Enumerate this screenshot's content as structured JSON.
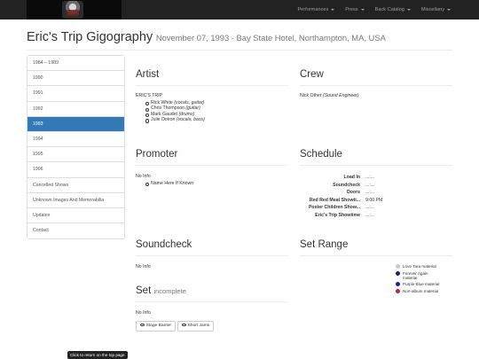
{
  "nav": {
    "items": [
      {
        "label": "Performances"
      },
      {
        "label": "Press"
      },
      {
        "label": "Back Catalog"
      },
      {
        "label": "Miscellany"
      }
    ]
  },
  "header": {
    "title": "Eric's Trip Gigography",
    "subtitle": "November 07, 1993 - Bay State Hotel, Northampton, MA, USA"
  },
  "sidebar": {
    "items": [
      {
        "label": "1984 – 1989"
      },
      {
        "label": "1990"
      },
      {
        "label": "1991"
      },
      {
        "label": "1992"
      },
      {
        "label": "1993",
        "active": true
      },
      {
        "label": "1994"
      },
      {
        "label": "1995"
      },
      {
        "label": "1996"
      },
      {
        "label": "Cancelled Shows"
      },
      {
        "label": "Unknown Images And Memorabilia"
      },
      {
        "label": "Updates"
      },
      {
        "label": "Contact"
      }
    ]
  },
  "artist": {
    "heading": "Artist",
    "name": "ERIC'S TRIP",
    "members": [
      {
        "name": "Rick White",
        "role": "(vocals, guitar)"
      },
      {
        "name": "Chris Thompson",
        "role": "(guitar)"
      },
      {
        "name": "Mark Gaudet",
        "role": "(drums)"
      },
      {
        "name": "Julie Doiron",
        "role": "(vocals, bass)"
      }
    ]
  },
  "crew": {
    "heading": "Crew",
    "name": "Nick Other",
    "role": "(Sound Engineer)"
  },
  "promoter": {
    "heading": "Promoter",
    "info": "No Info",
    "items": [
      "Name Here If Known"
    ]
  },
  "schedule": {
    "heading": "Schedule",
    "rows": [
      {
        "label": "Load In",
        "value": "...:..."
      },
      {
        "label": "Soundcheck",
        "value": "...:..."
      },
      {
        "label": "Doors",
        "value": "...:..."
      },
      {
        "label": "Red Red Meat Showti...",
        "value": "9:00 PM"
      },
      {
        "label": "Poster Children Show...",
        "value": "...:..."
      },
      {
        "label": "Eric's Trip Showtime",
        "value": "...:..."
      }
    ]
  },
  "soundcheck": {
    "heading": "Soundcheck",
    "info": "No Info"
  },
  "set_range": {
    "heading": "Set Range",
    "legend": [
      {
        "label": "Love Tara material",
        "color": "#cfc8cf"
      },
      {
        "label": "Forever Again material",
        "color": "#1f1a8a"
      },
      {
        "label": "Purple Blue material",
        "color": "#1c1ab8"
      },
      {
        "label": "Non-album material",
        "color": "#c01f4a"
      }
    ]
  },
  "set": {
    "heading": "Set",
    "status": "incomplete",
    "info": "No Info",
    "buttons": [
      {
        "label": "Stage Banter",
        "icon": "eye-icon"
      },
      {
        "label": "Short Jams",
        "icon": "eye-icon"
      }
    ]
  },
  "footer": {
    "top_link": "Click to return on the top page"
  }
}
